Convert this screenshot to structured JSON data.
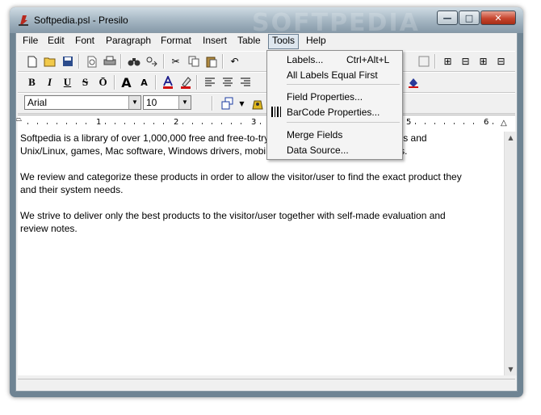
{
  "window": {
    "title": "Softpedia.psl - Presilo",
    "watermark": "SOFTPEDIA"
  },
  "caption_buttons": {
    "minimize": "—",
    "maximize": "□",
    "close": "✕"
  },
  "menubar": [
    "File",
    "Edit",
    "Font",
    "Paragraph",
    "Format",
    "Insert",
    "Table",
    "Tools",
    "Help"
  ],
  "format_toolbar": {
    "bold": "B",
    "italic": "I",
    "underline": "U",
    "strike": "S",
    "overline": "Ō",
    "grow": "A",
    "shrink": "A"
  },
  "font_box": {
    "font": "Arial",
    "size": "10"
  },
  "ruler": [
    "1",
    "2",
    "3",
    "4",
    "5",
    "6"
  ],
  "tools_menu": {
    "labels": "Labels...",
    "labels_shortcut": "Ctrl+Alt+L",
    "all_labels": "All Labels Equal First",
    "field_properties": "Field Properties...",
    "barcode_properties": "BarCode Properties...",
    "merge_fields": "Merge Fields",
    "data_source": "Data Source..."
  },
  "document": {
    "p1": "Softpedia is a library of over 1,000,000 free and free-to-try software programs for Windows and\nUnix/Linux, games, Mac software, Windows drivers, mobile devices and IT-related articles.",
    "p2": "We review and categorize these products in order to allow the visitor/user to find the exact product they\nand their system needs.",
    "p3": "We strive to deliver only the best products to the visitor/user together with self-made evaluation and\nreview notes."
  },
  "colors": {
    "accent_menu": "#dde6ee",
    "title_text": "#000000",
    "close_button": "#c7452e"
  }
}
